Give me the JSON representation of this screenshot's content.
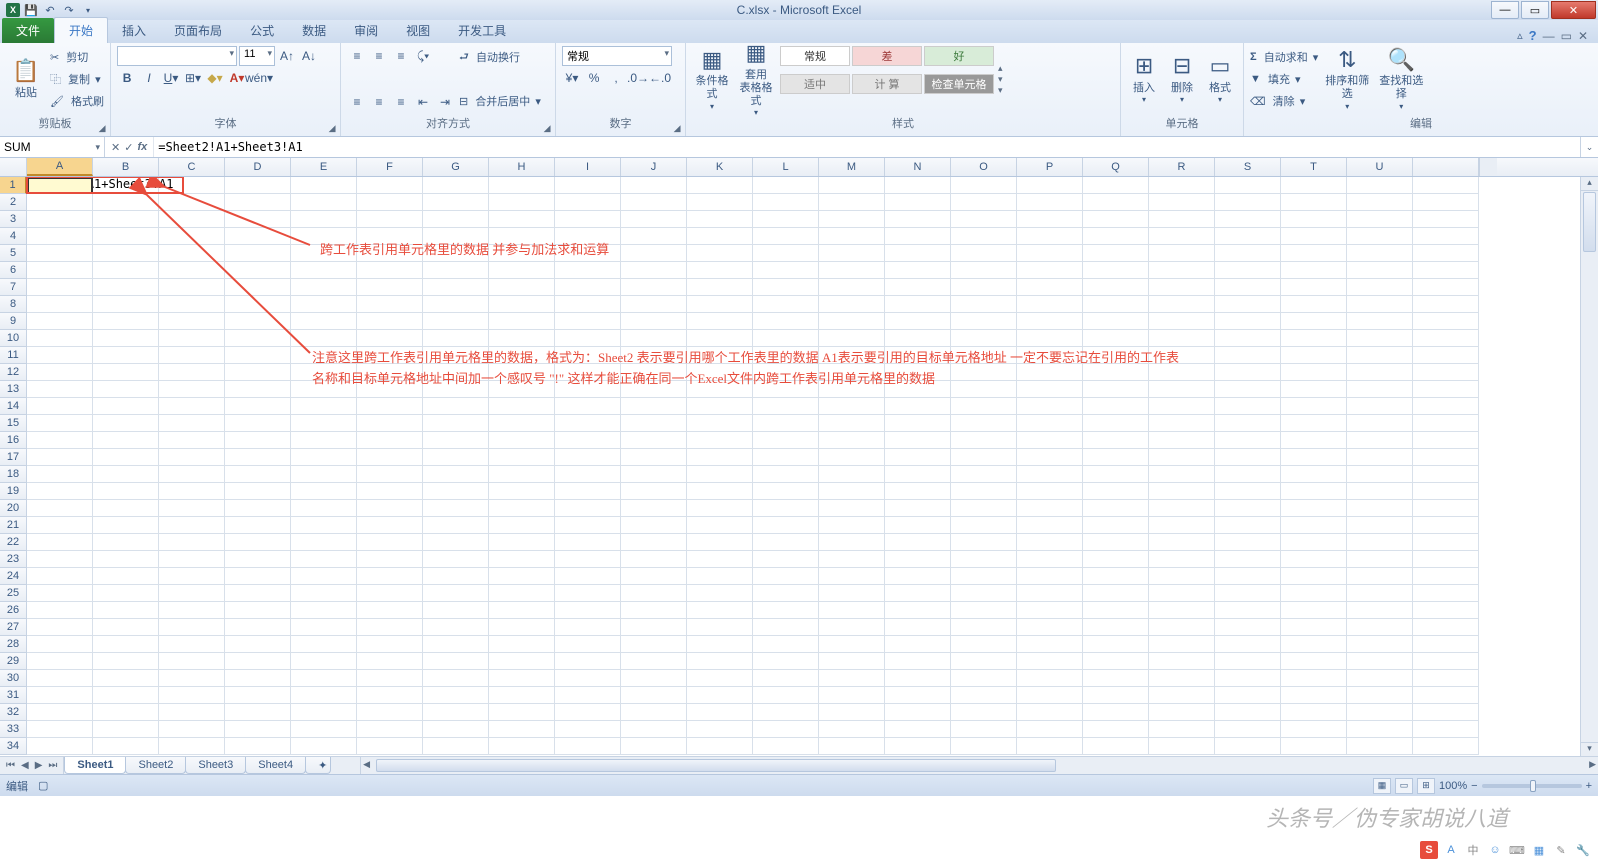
{
  "app": {
    "title": "C.xlsx - Microsoft Excel"
  },
  "tabs": {
    "file": "文件",
    "items": [
      "开始",
      "插入",
      "页面布局",
      "公式",
      "数据",
      "审阅",
      "视图",
      "开发工具"
    ],
    "active": 0
  },
  "ribbon": {
    "clipboard": {
      "paste": "粘贴",
      "cut": "剪切",
      "copy": "复制",
      "format_painter": "格式刷",
      "label": "剪贴板"
    },
    "font": {
      "size": "11",
      "label": "字体"
    },
    "align": {
      "wrap": "自动换行",
      "merge": "合并后居中",
      "label": "对齐方式"
    },
    "number": {
      "format": "常规",
      "label": "数字"
    },
    "styles": {
      "cond": "条件格式",
      "table": "套用\n表格格式",
      "cell": "单元格样式",
      "normal": "常规",
      "bad": "差",
      "good": "好",
      "neutral": "适中",
      "calc": "计 算",
      "check": "检查单元格",
      "label": "样式"
    },
    "cells": {
      "insert": "插入",
      "delete": "删除",
      "format": "格式",
      "label": "单元格"
    },
    "editing": {
      "autosum": "自动求和",
      "fill": "填充",
      "clear": "清除",
      "sort": "排序和筛选",
      "find": "查找和选择",
      "label": "编辑"
    }
  },
  "name_box": "SUM",
  "formula": "=Sheet2!A1+Sheet3!A1",
  "cell_a1": "=Sheet2!A1+Sheet3!A1",
  "columns": [
    "A",
    "B",
    "C",
    "D",
    "E",
    "F",
    "G",
    "H",
    "I",
    "J",
    "K",
    "L",
    "M",
    "N",
    "O",
    "P",
    "Q",
    "R",
    "S",
    "T",
    "U"
  ],
  "row_count": 34,
  "annotations": {
    "line1": "跨工作表引用单元格里的数据 并参与加法求和运算",
    "line2a": "注意这里跨工作表引用单元格里的数据，格式为：Sheet2 表示要引用哪个工作表里的数据  A1表示要引用的目标单元格地址  一定不要忘记在引用的工作表",
    "line2b": "名称和目标单元格地址中间加一个感叹号 \"!\" 这样才能正确在同一个Excel文件内跨工作表引用单元格里的数据"
  },
  "sheets": {
    "items": [
      "Sheet1",
      "Sheet2",
      "Sheet3",
      "Sheet4"
    ],
    "active": 0
  },
  "status": {
    "mode": "编辑",
    "zoom": "100%"
  },
  "watermark": "头条号／伪专家胡说八道"
}
